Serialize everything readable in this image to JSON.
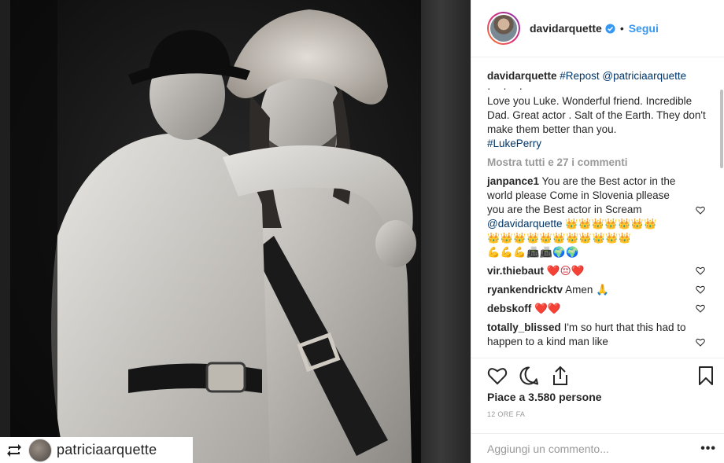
{
  "header": {
    "username": "davidarquette",
    "separator": "•",
    "follow_label": "Segui"
  },
  "caption": {
    "username": "davidarquette",
    "repost_tag": "#Repost",
    "mention": "@patriciaarquette",
    "dots": "· · ·",
    "text": "Love you Luke. Wonderful friend. Incredible Dad. Great actor . Salt of the Earth. They don't make them better than you.",
    "hashtag": "#LukePerry"
  },
  "show_all_comments": "Mostra tutti e 27 i commenti",
  "comments": [
    {
      "username": "janpance1",
      "text": "You are the Best actor in the world please Come in Slovenia plleasе you are the Best actor in Scream",
      "mention": "@davidarquette",
      "emoji_line1": "👑👑👑👑👑👑👑",
      "emoji_line2": "👑👑👑👑👑👑👑👑👑👑👑",
      "emoji_line3": "💪💪💪📠📠🌍🌍"
    },
    {
      "username": "vir.thiebaut",
      "text": "❤️😔❤️"
    },
    {
      "username": "ryankendricktv",
      "text": "Amen 🙏"
    },
    {
      "username": "debskoff",
      "text": "❤️❤️"
    },
    {
      "username": "totally_blissed",
      "text": "I'm so hurt that this had to happen to a kind man like"
    }
  ],
  "likes": "Piace a 3.580 persone",
  "timestamp": "12 ORE FA",
  "add_comment_placeholder": "Aggiungi un commento...",
  "more_options": "•••",
  "repost_badge": {
    "username": "patriciaarquette"
  },
  "icons": {
    "like": "heart-icon",
    "comment": "comment-icon",
    "share": "share-icon",
    "save": "bookmark-icon",
    "verified": "verified-badge-icon",
    "repost": "repost-icon"
  },
  "colors": {
    "link": "#003569",
    "follow": "#3897f0",
    "muted": "#999999",
    "heart_red": "#d7283a"
  }
}
